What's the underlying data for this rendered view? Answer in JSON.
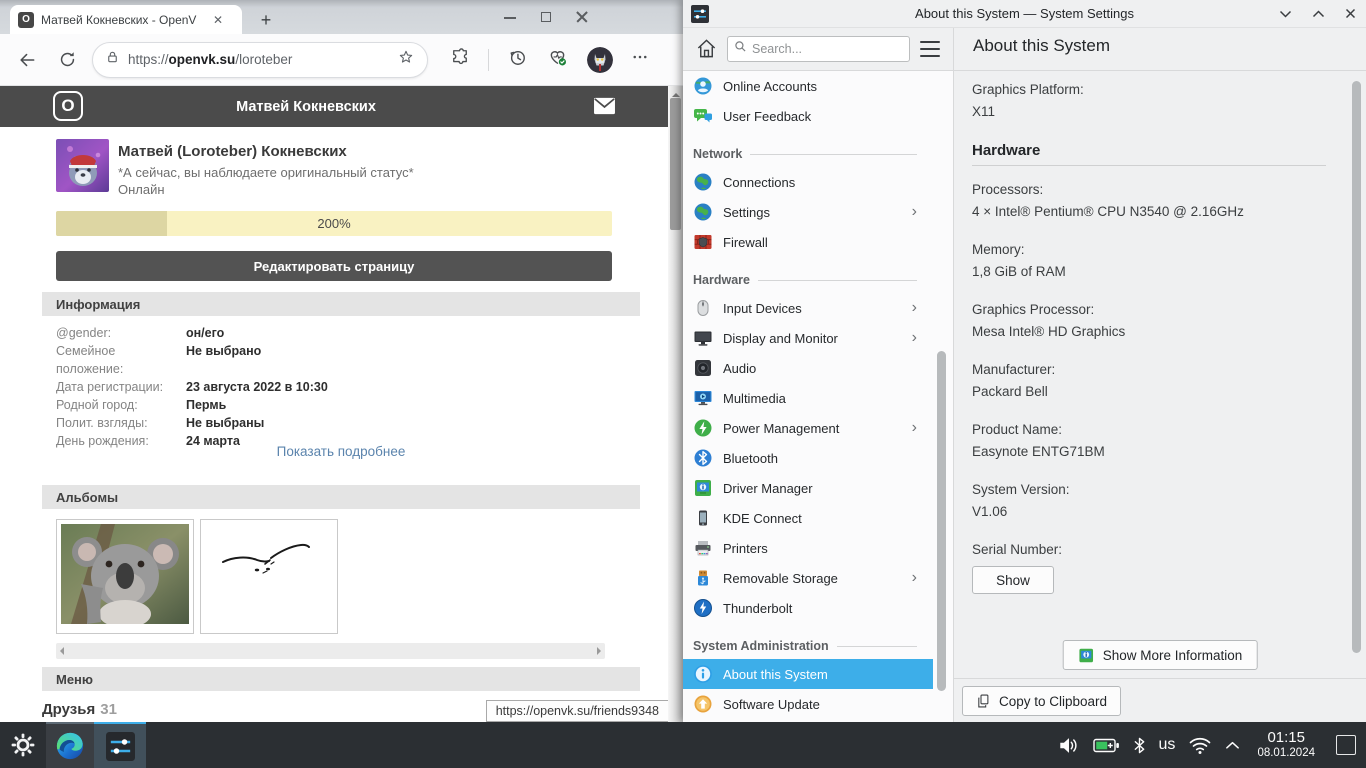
{
  "browser": {
    "tab": {
      "title": "Матвей Кокневских - OpenV",
      "favicon": "O"
    },
    "new_tab_label": "+",
    "url": {
      "scheme": "https://",
      "host": "openvk.su",
      "path": "/loroteber"
    },
    "status_link": "https://openvk.su/friends9348",
    "page": {
      "logo": "O",
      "header_title": "Матвей Кокневских",
      "profile": {
        "name": "Матвей (Loroteber) Кокневских",
        "status": "*А сейчас, вы наблюдаете оригинальный статус*",
        "online": "Онлайн",
        "rating": "200%",
        "rating_fill_percent": 20
      },
      "edit_button": "Редактировать страницу",
      "info_header": "Информация",
      "info_rows": [
        {
          "label": "@gender:",
          "value": "он/его"
        },
        {
          "label": "Семейное положение:",
          "value": "Не выбрано"
        },
        {
          "label": "Дата регистрации:",
          "value": "23 августа 2022 в 10:30"
        },
        {
          "label": "Родной город:",
          "value": "Пермь"
        },
        {
          "label": "Полит. взгляды:",
          "value": "Не выбраны"
        },
        {
          "label": "День рождения:",
          "value": "24 марта"
        }
      ],
      "show_more_link": "Показать подробнее",
      "albums_header": "Альбомы",
      "menu_header": "Меню",
      "friends_label": "Друзья",
      "friends_count": "31"
    }
  },
  "settings": {
    "titlebar": "About this System — System Settings",
    "search_placeholder": "Search...",
    "heading": "About this System",
    "sidebar": [
      {
        "type": "item",
        "label": "Online Accounts",
        "icon": "online-accounts"
      },
      {
        "type": "item",
        "label": "User Feedback",
        "icon": "user-feedback"
      },
      {
        "type": "section",
        "label": "Network"
      },
      {
        "type": "item",
        "label": "Connections",
        "icon": "connections"
      },
      {
        "type": "item",
        "label": "Settings",
        "icon": "network-settings",
        "chevron": true
      },
      {
        "type": "item",
        "label": "Firewall",
        "icon": "firewall"
      },
      {
        "type": "section",
        "label": "Hardware"
      },
      {
        "type": "item",
        "label": "Input Devices",
        "icon": "input-devices",
        "chevron": true
      },
      {
        "type": "item",
        "label": "Display and Monitor",
        "icon": "display-monitor",
        "chevron": true
      },
      {
        "type": "item",
        "label": "Audio",
        "icon": "audio"
      },
      {
        "type": "item",
        "label": "Multimedia",
        "icon": "multimedia"
      },
      {
        "type": "item",
        "label": "Power Management",
        "icon": "power-management",
        "chevron": true
      },
      {
        "type": "item",
        "label": "Bluetooth",
        "icon": "bluetooth"
      },
      {
        "type": "item",
        "label": "Driver Manager",
        "icon": "driver-manager"
      },
      {
        "type": "item",
        "label": "KDE Connect",
        "icon": "kde-connect"
      },
      {
        "type": "item",
        "label": "Printers",
        "icon": "printers"
      },
      {
        "type": "item",
        "label": "Removable Storage",
        "icon": "removable-storage",
        "chevron": true
      },
      {
        "type": "item",
        "label": "Thunderbolt",
        "icon": "thunderbolt"
      },
      {
        "type": "section",
        "label": "System Administration"
      },
      {
        "type": "item",
        "label": "About this System",
        "icon": "about-system",
        "selected": true
      },
      {
        "type": "item",
        "label": "Software Update",
        "icon": "software-update"
      }
    ],
    "about": {
      "software_fields": [
        {
          "label": "Graphics Platform:",
          "value": "X11"
        }
      ],
      "hardware_header": "Hardware",
      "hardware_fields": [
        {
          "label": "Processors:",
          "value": "4 × Intel® Pentium® CPU N3540 @ 2.16GHz"
        },
        {
          "label": "Memory:",
          "value": "1,8 GiB of RAM"
        },
        {
          "label": "Graphics Processor:",
          "value": "Mesa Intel® HD Graphics"
        },
        {
          "label": "Manufacturer:",
          "value": "Packard Bell"
        },
        {
          "label": "Product Name:",
          "value": "Easynote ENTG71BM"
        },
        {
          "label": "System Version:",
          "value": "V1.06"
        }
      ],
      "serial_label": "Serial Number:",
      "serial_show_button": "Show"
    },
    "show_more_button": "Show More Information",
    "copy_button": "Copy to Clipboard"
  },
  "taskbar": {
    "keyboard_layout": "us",
    "time": "01:15",
    "date": "08.01.2024"
  }
}
